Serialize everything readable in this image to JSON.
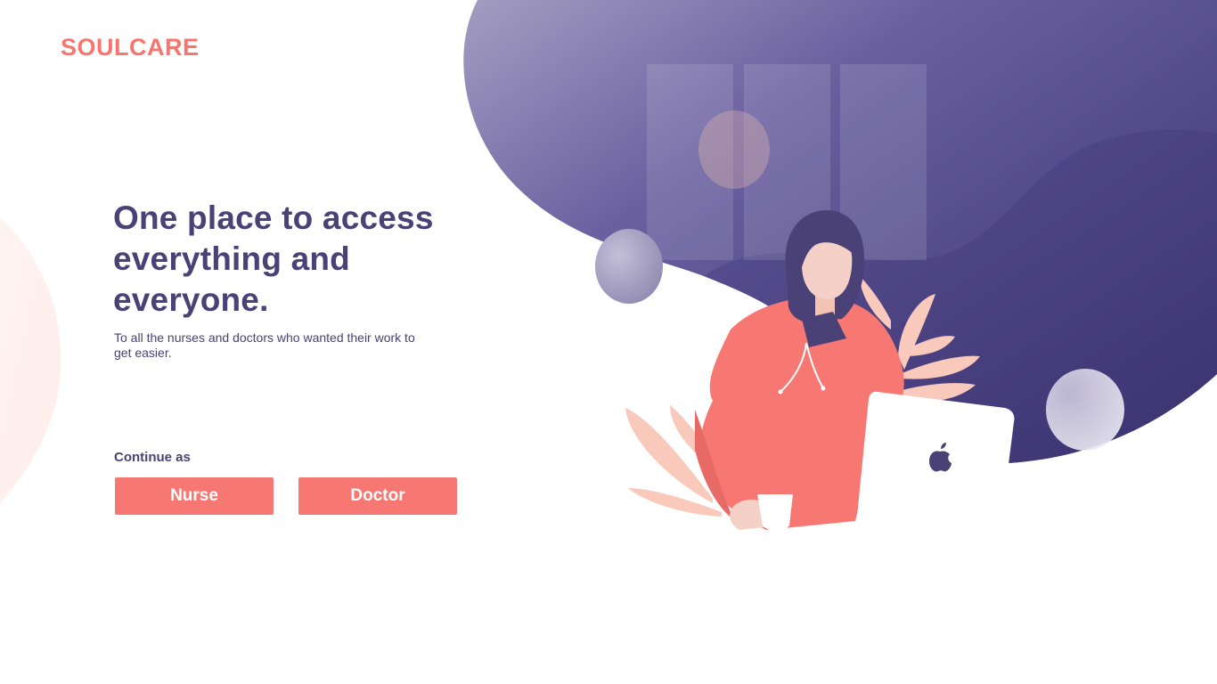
{
  "brand": {
    "name": "SOULCARE",
    "color": "#F6756F"
  },
  "hero": {
    "headline": "One place to access everything and everyone.",
    "subtitle": "To all the nurses and doctors who wanted their work to get easier.",
    "text_color": "#4A4177"
  },
  "continue": {
    "label": "Continue as",
    "buttons": [
      {
        "label": "Nurse"
      },
      {
        "label": "Doctor"
      }
    ],
    "button_color": "#F77772"
  },
  "illustration": {
    "subject": "woman-with-laptop",
    "laptop_icon": "apple-icon",
    "blob_gradient": [
      "#9B94BB",
      "#3B3270"
    ]
  }
}
